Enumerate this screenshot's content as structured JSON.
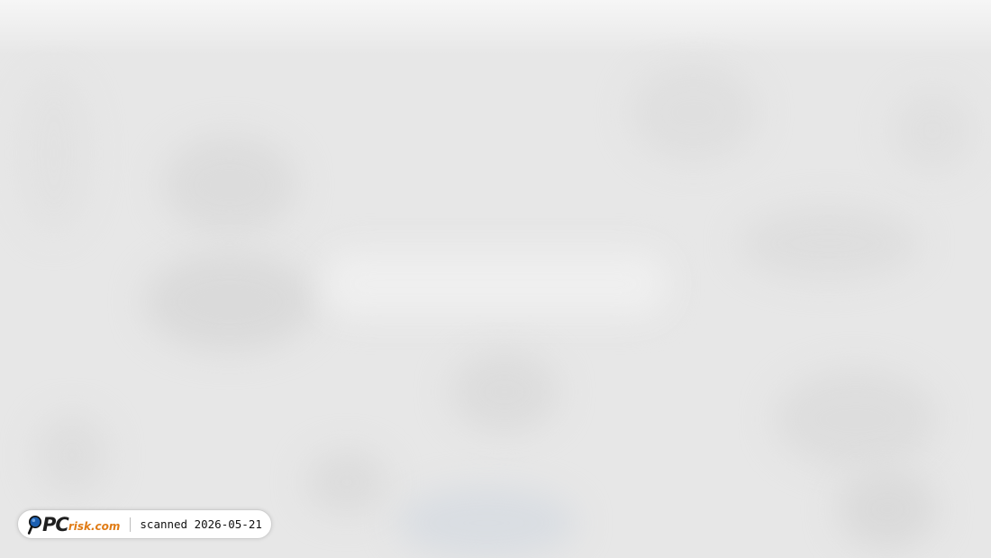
{
  "badge": {
    "logo_brand": "PC",
    "logo_domain": "risk.com",
    "scan_label": "scanned",
    "scan_date": "2026-05-21",
    "colors": {
      "brand_dark": "#1f1f1f",
      "brand_orange": "#e07b14",
      "magnifier_blue": "#1c5fb0"
    },
    "icon": "magnifier-icon"
  },
  "background": {
    "state": "blurred page content",
    "color": "#e7e7e7"
  }
}
